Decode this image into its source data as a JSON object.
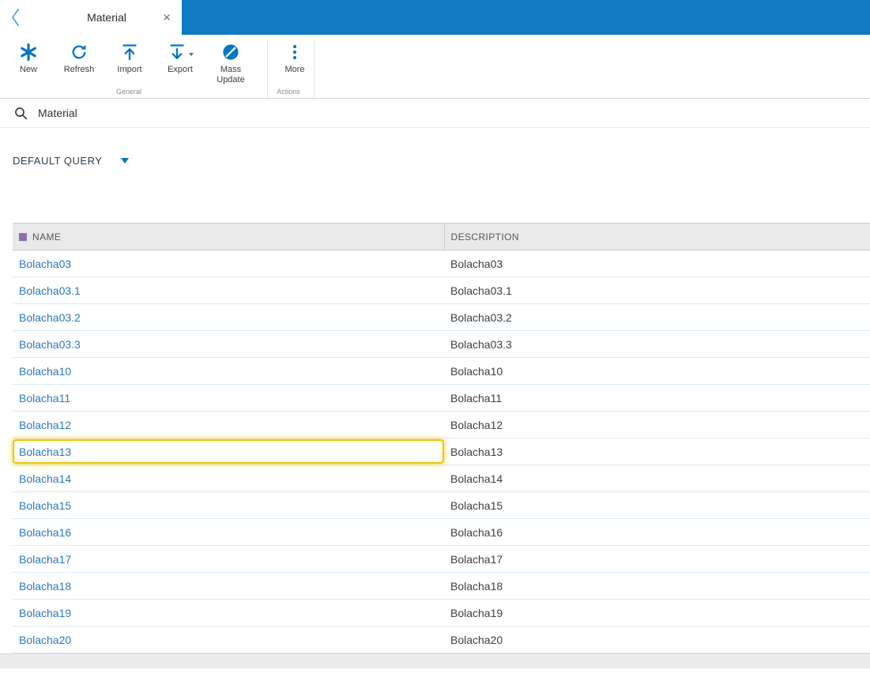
{
  "colors": {
    "top_bar_blue": "#0e7ac4",
    "icon_blue": "#0077c0",
    "link_blue": "#2a79bd",
    "highlight_yellow": "#eec411",
    "header_bg": "#e9e9ea",
    "name_marker_purple": "#8e6fae"
  },
  "tab_bar": {
    "tab_label": "Material",
    "close_glyph": "×"
  },
  "toolbar": {
    "buttons": [
      {
        "id": "new",
        "label": "New"
      },
      {
        "id": "refresh",
        "label": "Refresh"
      },
      {
        "id": "import",
        "label": "Import"
      },
      {
        "id": "export",
        "label": "Export"
      },
      {
        "id": "mass-update",
        "label": "Mass Update"
      },
      {
        "id": "more",
        "label": "More"
      }
    ],
    "groups": [
      {
        "label": "General"
      },
      {
        "label": "Actions"
      }
    ]
  },
  "search": {
    "value": "Material"
  },
  "query": {
    "label": "DEFAULT QUERY"
  },
  "table": {
    "columns": [
      {
        "label": "NAME"
      },
      {
        "label": "DESCRIPTION"
      }
    ],
    "rows": [
      {
        "name": "Bolacha03",
        "description": "Bolacha03",
        "highlighted": false
      },
      {
        "name": "Bolacha03.1",
        "description": "Bolacha03.1",
        "highlighted": false
      },
      {
        "name": "Bolacha03.2",
        "description": "Bolacha03.2",
        "highlighted": false
      },
      {
        "name": "Bolacha03.3",
        "description": "Bolacha03.3",
        "highlighted": false
      },
      {
        "name": "Bolacha10",
        "description": "Bolacha10",
        "highlighted": false
      },
      {
        "name": "Bolacha11",
        "description": "Bolacha11",
        "highlighted": false
      },
      {
        "name": "Bolacha12",
        "description": "Bolacha12",
        "highlighted": false
      },
      {
        "name": "Bolacha13",
        "description": "Bolacha13",
        "highlighted": true
      },
      {
        "name": "Bolacha14",
        "description": "Bolacha14",
        "highlighted": false
      },
      {
        "name": "Bolacha15",
        "description": "Bolacha15",
        "highlighted": false
      },
      {
        "name": "Bolacha16",
        "description": "Bolacha16",
        "highlighted": false
      },
      {
        "name": "Bolacha17",
        "description": "Bolacha17",
        "highlighted": false
      },
      {
        "name": "Bolacha18",
        "description": "Bolacha18",
        "highlighted": false
      },
      {
        "name": "Bolacha19",
        "description": "Bolacha19",
        "highlighted": false
      },
      {
        "name": "Bolacha20",
        "description": "Bolacha20",
        "highlighted": false
      }
    ]
  }
}
